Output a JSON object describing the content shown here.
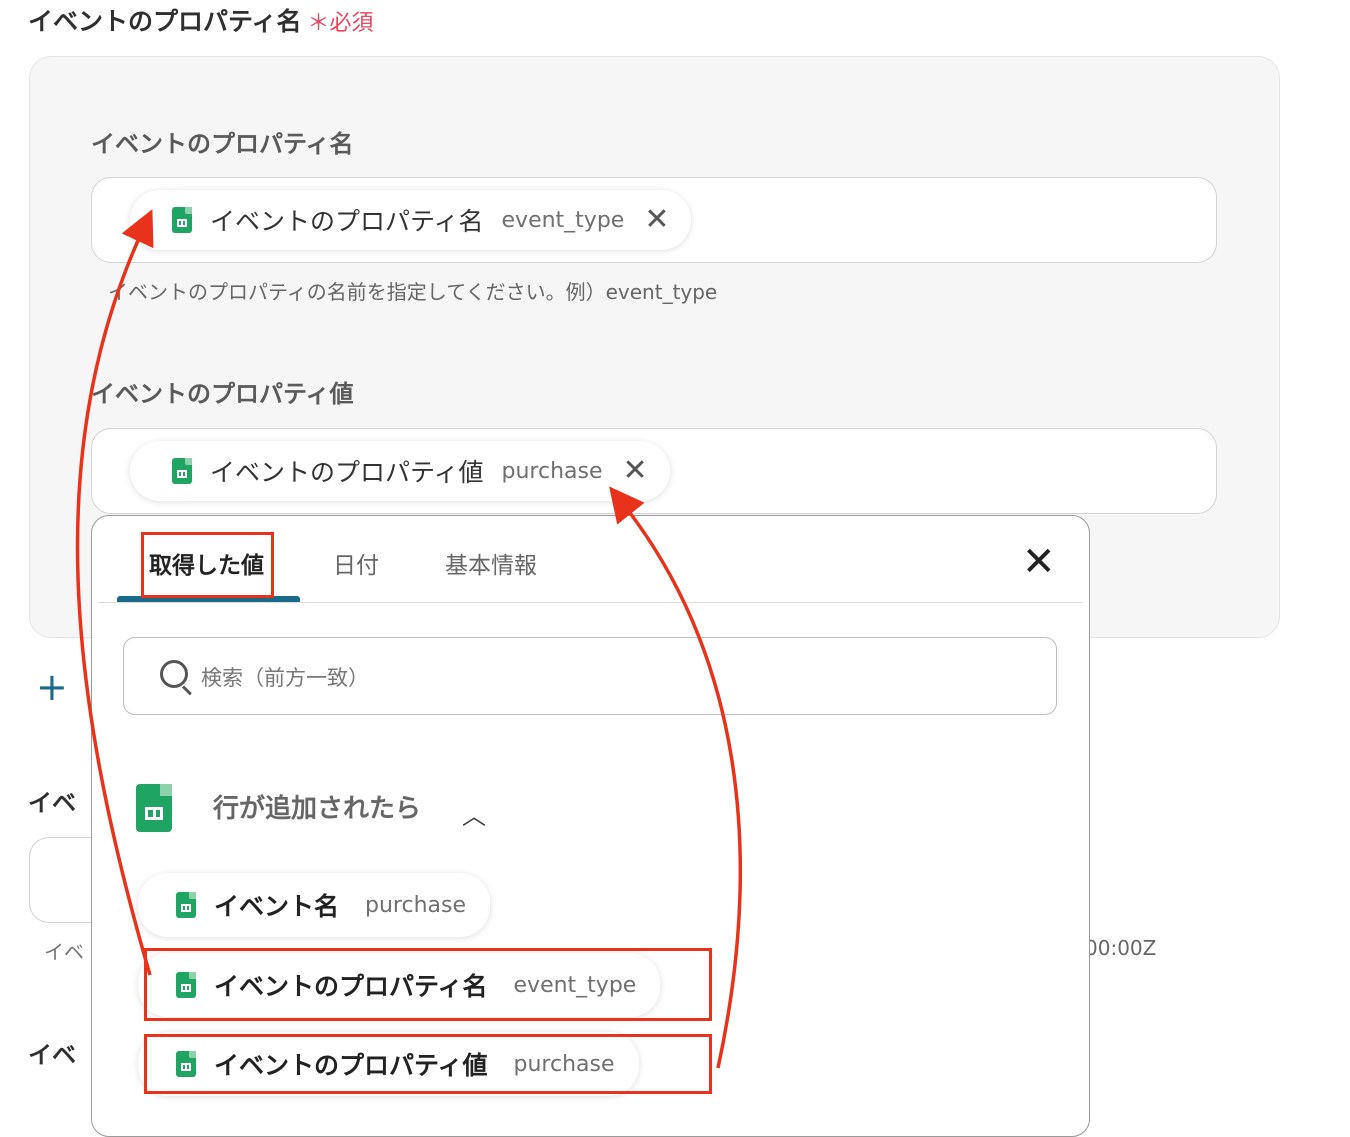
{
  "section": {
    "title": "イベントのプロパティ名",
    "required": "＊必須"
  },
  "fields": {
    "name": {
      "label": "イベントのプロパティ名",
      "chip": {
        "label": "イベントのプロパティ名",
        "value": "event_type"
      },
      "hint": "イベントのプロパティの名前を指定してください。例）event_type"
    },
    "value": {
      "label": "イベントのプロパティ値",
      "chip": {
        "label": "イベントのプロパティ値",
        "value": "purchase"
      }
    }
  },
  "background": {
    "partial_label_1": "イベ",
    "partial_label_2": "イベ",
    "partial_hint": "イベ",
    "right_fragment": "00:00Z"
  },
  "popup": {
    "tabs": [
      "取得した値",
      "日付",
      "基本情報"
    ],
    "active_tab": 0,
    "search_placeholder": "検索（前方一致）",
    "trigger": {
      "label": "行が追加されたら",
      "expanded": true
    },
    "items": [
      {
        "label": "イベント名",
        "value": "purchase"
      },
      {
        "label": "イベントのプロパティ名",
        "value": "event_type"
      },
      {
        "label": "イベントのプロパティ値",
        "value": "purchase"
      }
    ]
  },
  "colors": {
    "accent": "#1a6b8a",
    "required": "#e8475f",
    "highlight": "#e8321b",
    "sheets_green": "#1fa463"
  },
  "icons": {
    "chip_remove": "close-icon",
    "sheets": "google-sheets-icon",
    "popup_close": "close-icon",
    "search": "search-icon",
    "add": "plus-icon",
    "collapse": "chevron-up-icon"
  }
}
